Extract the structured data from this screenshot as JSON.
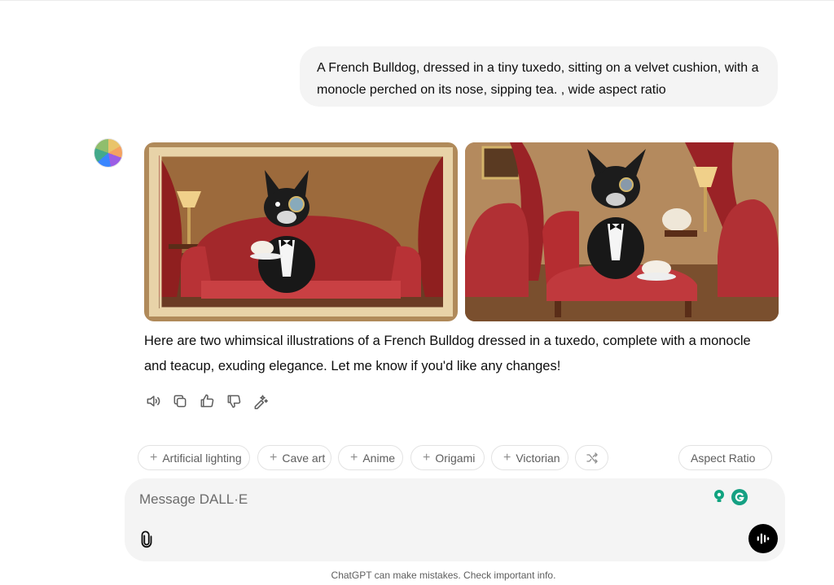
{
  "conversation": {
    "user_message": "A French Bulldog, dressed in a tiny tuxedo, sitting on a velvet cushion, with a monocle perched on its nose, sipping tea. , wide aspect ratio",
    "assistant_reply": "Here are two whimsical illustrations of a French Bulldog dressed in a tuxedo, complete with a monocle and teacup, exuding elegance. Let me know if you'd like any changes!",
    "images": [
      {
        "alt": "French Bulldog in a tuxedo with a monocle sipping tea on a red velvet sofa, framed"
      },
      {
        "alt": "French Bulldog in a tuxedo with a monocle sitting on a red velvet cushion with a teapot"
      }
    ],
    "actions": [
      {
        "icon": "speaker-icon"
      },
      {
        "icon": "copy-icon"
      },
      {
        "icon": "thumbs-up-icon"
      },
      {
        "icon": "thumbs-down-icon"
      },
      {
        "icon": "edit-sparkle-icon"
      }
    ]
  },
  "style_chips": [
    {
      "label": "Artificial lighting"
    },
    {
      "label": "Cave art"
    },
    {
      "label": "Anime"
    },
    {
      "label": "Origami"
    },
    {
      "label": "Victorian"
    }
  ],
  "aspect_ratio_label": "Aspect Ratio",
  "composer": {
    "placeholder": "Message DALL·E",
    "value": ""
  },
  "footer": "ChatGPT can make mistakes. Check important info.",
  "colors": {
    "bubble_bg": "#f4f4f4",
    "chip_border": "#e3e3e3",
    "voice_button": "#000000",
    "extension_green": "#10a37f"
  }
}
